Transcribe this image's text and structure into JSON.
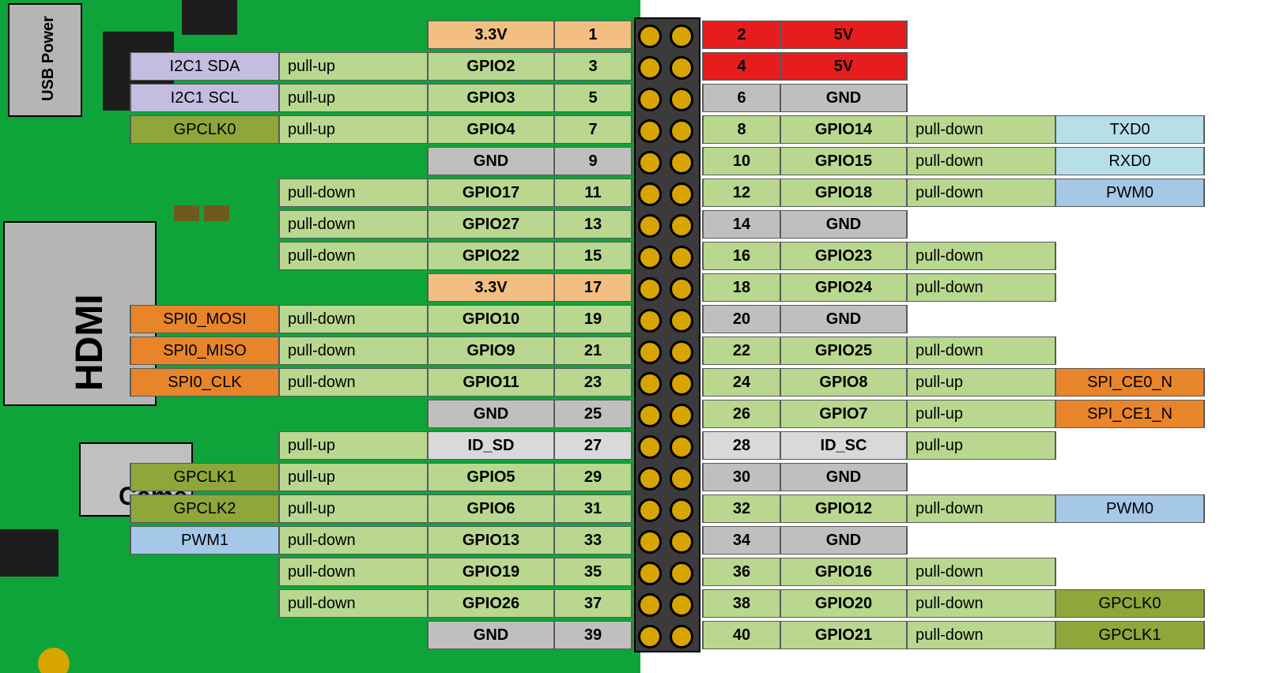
{
  "board": {
    "usb_power": "USB\nPower",
    "hdmi": "HDMI",
    "camera": "Came"
  },
  "alt_colors": {
    "I2C1 SDA": "f-purple",
    "I2C1 SCL": "f-purple",
    "GPCLK0": "f-olive",
    "GPCLK1": "f-olive",
    "GPCLK2": "f-olive",
    "SPI0_MOSI": "f-orange",
    "SPI0_MISO": "f-orange",
    "SPI0_CLK": "f-orange",
    "SPI_CE0_N": "f-orange",
    "SPI_CE1_N": "f-orange",
    "PWM0": "f-sky",
    "PWM1": "f-sky",
    "TXD0": "f-lightblue",
    "RXD0": "f-lightblue"
  },
  "name_colors": {
    "3.3V": "f-3v3",
    "5V": "f-5v",
    "GND": "f-gnd",
    "ID_SD": "f-idsd",
    "ID_SC": "f-idsd"
  },
  "pins_left": [
    {
      "num": "1",
      "name": "3.3V",
      "pull": "",
      "alt": ""
    },
    {
      "num": "3",
      "name": "GPIO2",
      "pull": "pull-up",
      "alt": "I2C1 SDA"
    },
    {
      "num": "5",
      "name": "GPIO3",
      "pull": "pull-up",
      "alt": "I2C1 SCL"
    },
    {
      "num": "7",
      "name": "GPIO4",
      "pull": "pull-up",
      "alt": "GPCLK0"
    },
    {
      "num": "9",
      "name": "GND",
      "pull": "",
      "alt": ""
    },
    {
      "num": "11",
      "name": "GPIO17",
      "pull": "pull-down",
      "alt": ""
    },
    {
      "num": "13",
      "name": "GPIO27",
      "pull": "pull-down",
      "alt": ""
    },
    {
      "num": "15",
      "name": "GPIO22",
      "pull": "pull-down",
      "alt": ""
    },
    {
      "num": "17",
      "name": "3.3V",
      "pull": "",
      "alt": ""
    },
    {
      "num": "19",
      "name": "GPIO10",
      "pull": "pull-down",
      "alt": "SPI0_MOSI"
    },
    {
      "num": "21",
      "name": "GPIO9",
      "pull": "pull-down",
      "alt": "SPI0_MISO"
    },
    {
      "num": "23",
      "name": "GPIO11",
      "pull": "pull-down",
      "alt": "SPI0_CLK"
    },
    {
      "num": "25",
      "name": "GND",
      "pull": "",
      "alt": ""
    },
    {
      "num": "27",
      "name": "ID_SD",
      "pull": "pull-up",
      "alt": ""
    },
    {
      "num": "29",
      "name": "GPIO5",
      "pull": "pull-up",
      "alt": "GPCLK1"
    },
    {
      "num": "31",
      "name": "GPIO6",
      "pull": "pull-up",
      "alt": "GPCLK2"
    },
    {
      "num": "33",
      "name": "GPIO13",
      "pull": "pull-down",
      "alt": "PWM1"
    },
    {
      "num": "35",
      "name": "GPIO19",
      "pull": "pull-down",
      "alt": ""
    },
    {
      "num": "37",
      "name": "GPIO26",
      "pull": "pull-down",
      "alt": ""
    },
    {
      "num": "39",
      "name": "GND",
      "pull": "",
      "alt": ""
    }
  ],
  "pins_right": [
    {
      "num": "2",
      "name": "5V",
      "pull": "",
      "alt": ""
    },
    {
      "num": "4",
      "name": "5V",
      "pull": "",
      "alt": ""
    },
    {
      "num": "6",
      "name": "GND",
      "pull": "",
      "alt": ""
    },
    {
      "num": "8",
      "name": "GPIO14",
      "pull": "pull-down",
      "alt": "TXD0"
    },
    {
      "num": "10",
      "name": "GPIO15",
      "pull": "pull-down",
      "alt": "RXD0"
    },
    {
      "num": "12",
      "name": "GPIO18",
      "pull": "pull-down",
      "alt": "PWM0"
    },
    {
      "num": "14",
      "name": "GND",
      "pull": "",
      "alt": ""
    },
    {
      "num": "16",
      "name": "GPIO23",
      "pull": "pull-down",
      "alt": ""
    },
    {
      "num": "18",
      "name": "GPIO24",
      "pull": "pull-down",
      "alt": ""
    },
    {
      "num": "20",
      "name": "GND",
      "pull": "",
      "alt": ""
    },
    {
      "num": "22",
      "name": "GPIO25",
      "pull": "pull-down",
      "alt": ""
    },
    {
      "num": "24",
      "name": "GPIO8",
      "pull": "pull-up",
      "alt": "SPI_CE0_N"
    },
    {
      "num": "26",
      "name": "GPIO7",
      "pull": "pull-up",
      "alt": "SPI_CE1_N"
    },
    {
      "num": "28",
      "name": "ID_SC",
      "pull": "pull-up",
      "alt": ""
    },
    {
      "num": "30",
      "name": "GND",
      "pull": "",
      "alt": ""
    },
    {
      "num": "32",
      "name": "GPIO12",
      "pull": "pull-down",
      "alt": "PWM0"
    },
    {
      "num": "34",
      "name": "GND",
      "pull": "",
      "alt": ""
    },
    {
      "num": "36",
      "name": "GPIO16",
      "pull": "pull-down",
      "alt": ""
    },
    {
      "num": "38",
      "name": "GPIO20",
      "pull": "pull-down",
      "alt": "GPCLK0"
    },
    {
      "num": "40",
      "name": "GPIO21",
      "pull": "pull-down",
      "alt": "GPCLK1"
    }
  ]
}
